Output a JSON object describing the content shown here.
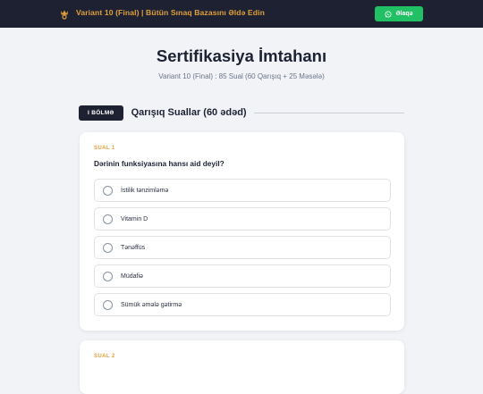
{
  "topbar": {
    "brand_icon": "graduation-crown-icon",
    "brand_text": "Variant 10 (Final) | Bütün Sınaq Bazasını Əldə Edin",
    "contact_icon": "whatsapp-icon",
    "contact_label": "Əlaqə",
    "colors": {
      "bar": "#1d2132",
      "accent": "#e0a03b",
      "button": "#22c064"
    }
  },
  "header": {
    "title": "Sertifikasiya İmtahanı",
    "subtitle": "Variant 10 (Final) : 85 Sual (60 Qarışıq + 25 Məsələ)"
  },
  "section": {
    "badge": "I BÖLMƏ",
    "title": "Qarışıq Suallar (60 ədəd)"
  },
  "questions": [
    {
      "label": "SUAL 1",
      "text": "Dərinin funksiyasına hansı aid deyil?",
      "options": [
        "İstilik tənzimləmə",
        "Vitamin D",
        "Tənəffüs",
        "Müdafiə",
        "Sümük əmələ gətirmə"
      ]
    },
    {
      "label": "SUAL 2"
    }
  ]
}
